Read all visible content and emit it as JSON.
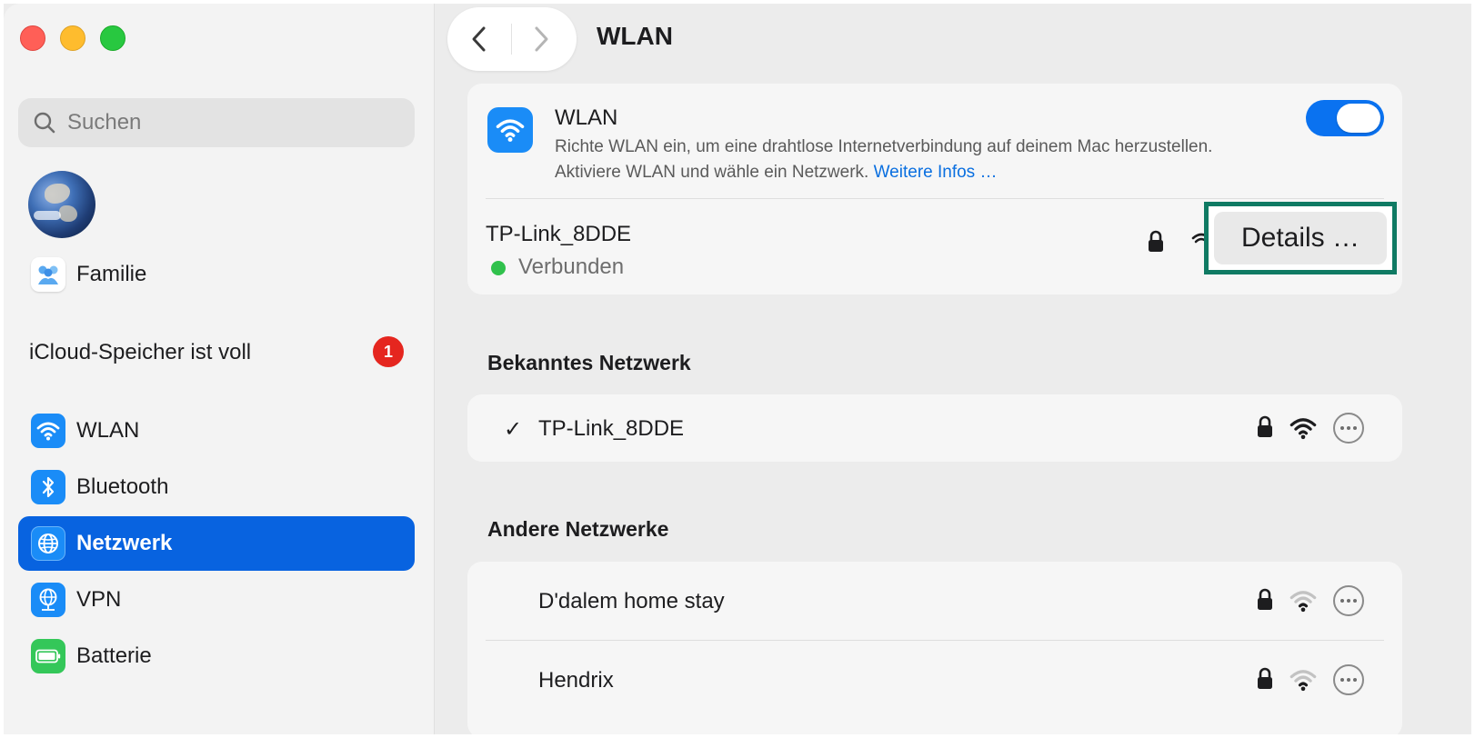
{
  "window": {
    "title": "WLAN"
  },
  "sidebar": {
    "search_placeholder": "Suchen",
    "family_label": "Familie",
    "icloud_label": "iCloud-Speicher ist voll",
    "icloud_badge": "1",
    "items": [
      {
        "label": "WLAN",
        "icon": "wifi-icon",
        "color": "#1a8cf7",
        "active": false
      },
      {
        "label": "Bluetooth",
        "icon": "bluetooth-icon",
        "color": "#1a8cf7",
        "active": false
      },
      {
        "label": "Netzwerk",
        "icon": "globe-icon",
        "color": "#1a8cf7",
        "active": true
      },
      {
        "label": "VPN",
        "icon": "vpn-globe-icon",
        "color": "#1a8cf7",
        "active": false
      },
      {
        "label": "Batterie",
        "icon": "battery-icon",
        "color": "#34c759",
        "active": false
      }
    ]
  },
  "toolbar": {
    "back": "back-chevron-icon",
    "forward": "forward-chevron-icon"
  },
  "wlan": {
    "title": "WLAN",
    "description": "Richte WLAN ein, um eine drahtlose Internetverbindung auf deinem Mac herzustellen. Aktiviere WLAN und wähle ein Netzwerk.",
    "more_link": "Weitere Infos …",
    "enabled": true,
    "current_network": "TP-Link_8DDE",
    "status": "Verbunden",
    "details_button": "Details …"
  },
  "known": {
    "heading": "Bekanntes Netzwerk",
    "networks": [
      {
        "name": "TP-Link_8DDE",
        "checked": true,
        "locked": true,
        "signal": "strong"
      }
    ]
  },
  "other": {
    "heading": "Andere Netzwerke",
    "networks": [
      {
        "name": "D'dalem home stay",
        "locked": true,
        "signal": "weak"
      },
      {
        "name": "Hendrix",
        "locked": true,
        "signal": "weak"
      }
    ]
  },
  "colors": {
    "accent": "#0863e0",
    "highlight_box": "#0f7a63",
    "connected": "#30c14c",
    "badge": "#e5261f"
  }
}
